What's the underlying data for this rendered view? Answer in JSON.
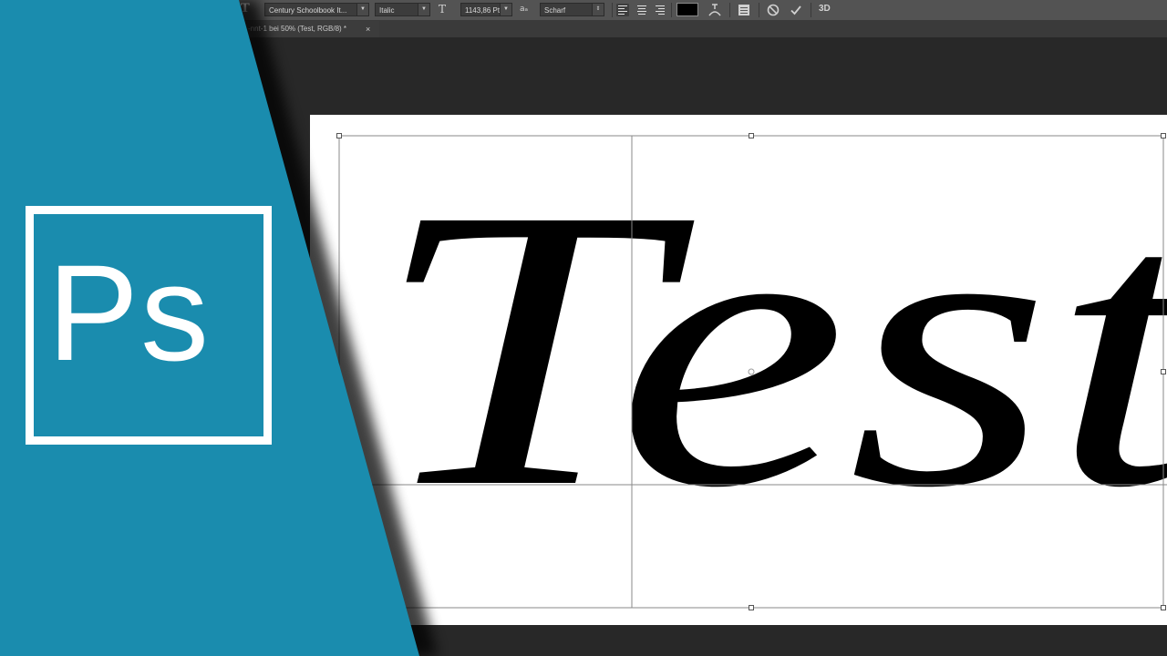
{
  "options_bar": {
    "tool_icon": "type-tool-icon",
    "font_family": "Century Schoolbook It...",
    "font_style": "Italic",
    "font_size": "1143,86 Pt",
    "antialias": "Scharf",
    "size_glyph": "T",
    "aa_glyph": "aₐ",
    "color": "#000000",
    "icons": [
      "align-left-icon",
      "align-center-icon",
      "align-right-icon",
      "warp-text-icon",
      "character-panel-icon",
      "cancel-icon",
      "commit-icon"
    ],
    "threed_label": "3D"
  },
  "document_tab": {
    "title": "-nnt-1 bei 50% (Test, RGB/8) *",
    "close": "×"
  },
  "canvas": {
    "text": "Test",
    "text_color": "#000000",
    "background": "#ffffff"
  },
  "overlay": {
    "logo_text": "Ps",
    "color": "#1a8cae"
  }
}
